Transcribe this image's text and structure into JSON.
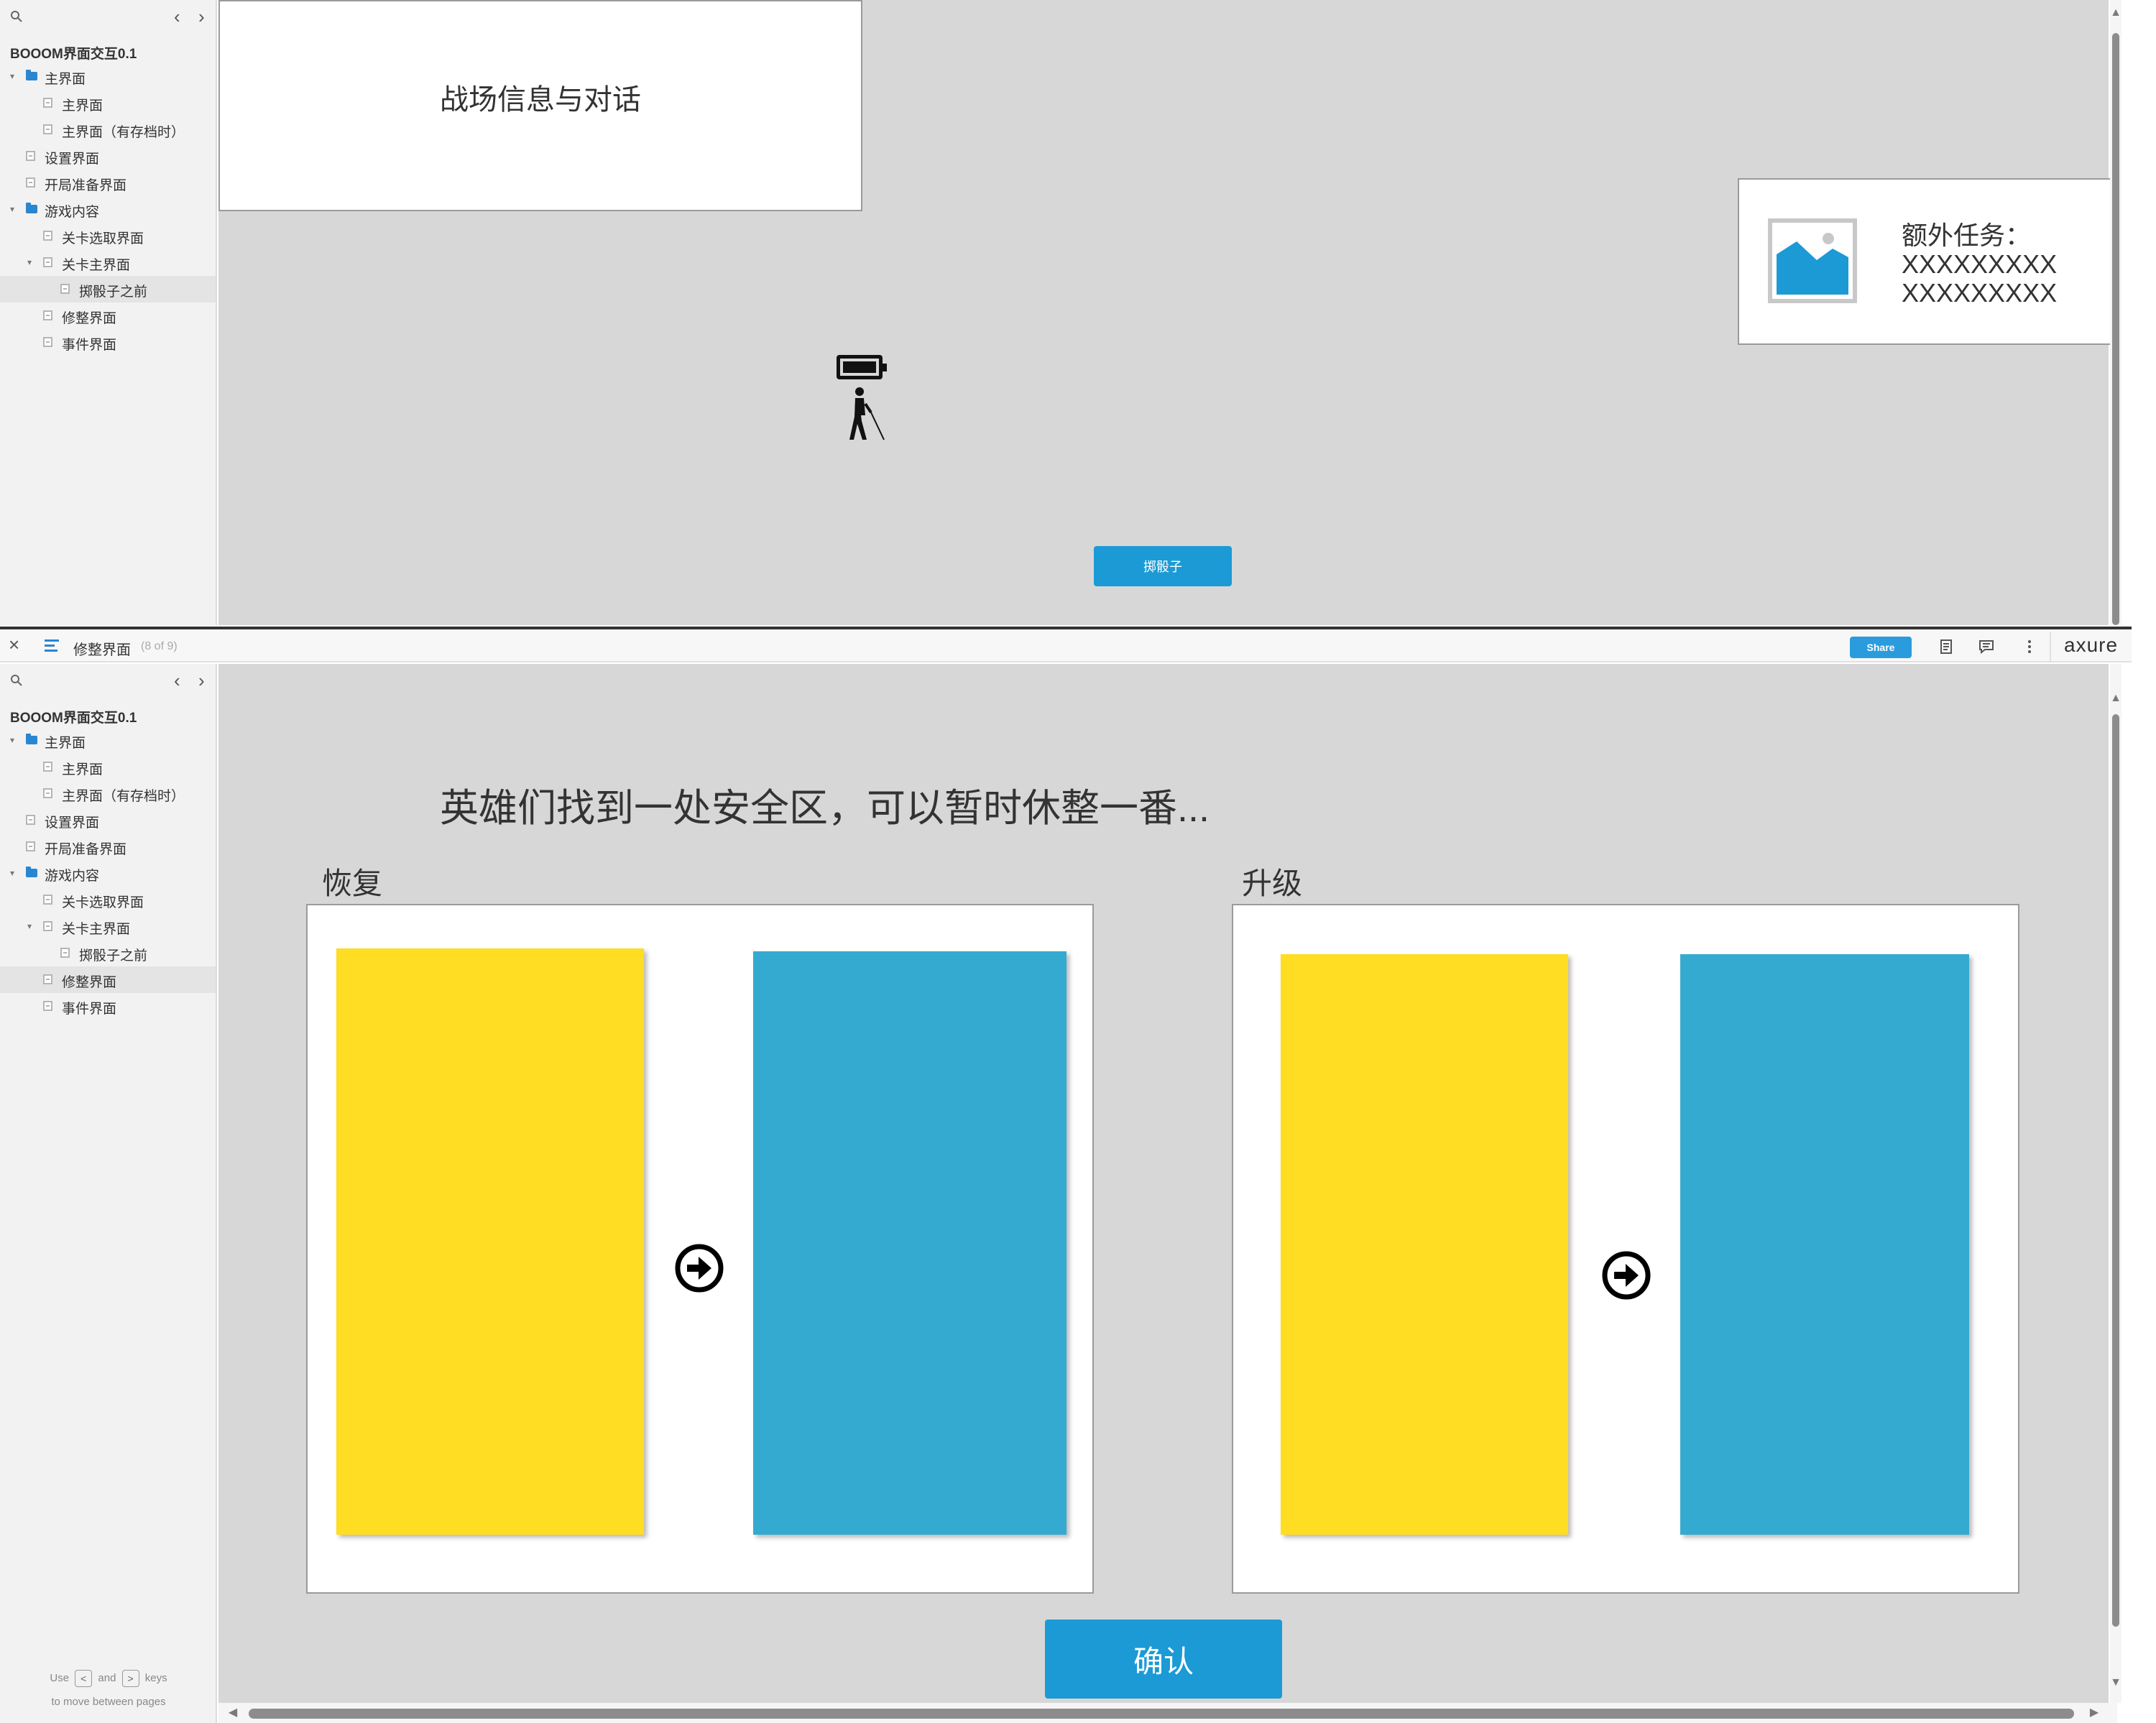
{
  "project_title": "BOOOM界面交互0.1",
  "sitemap": [
    {
      "label": "主界面",
      "type": "folder",
      "level": 0
    },
    {
      "label": "主界面",
      "type": "page",
      "level": 1
    },
    {
      "label": "主界面（有存档时）",
      "type": "page",
      "level": 1
    },
    {
      "label": "设置界面",
      "type": "page",
      "level": 0
    },
    {
      "label": "开局准备界面",
      "type": "page",
      "level": 0
    },
    {
      "label": "游戏内容",
      "type": "folder",
      "level": 0
    },
    {
      "label": "关卡选取界面",
      "type": "page",
      "level": 1
    },
    {
      "label": "关卡主界面",
      "type": "page",
      "level": 1
    },
    {
      "label": "掷骰子之前",
      "type": "page",
      "level": 2
    },
    {
      "label": "修整界面",
      "type": "page",
      "level": 1
    },
    {
      "label": "事件界面",
      "type": "page",
      "level": 1
    }
  ],
  "top_window": {
    "dialog_title": "战场信息与对话",
    "task_label": "额外任务：",
    "task_lines": [
      "XXXXXXXXX",
      "XXXXXXXXX"
    ],
    "dice_button": "掷骰子",
    "selected_page": "掷骰子之前"
  },
  "toolbar": {
    "close": "×",
    "page_name": "修整界面",
    "page_count": "(8 of 9)",
    "share_label": "Share",
    "brand": "axure"
  },
  "bottom_window": {
    "selected_page": "修整界面",
    "headline": "英雄们找到一处安全区，可以暂时休整一番...",
    "recover_label": "恢复",
    "upgrade_label": "升级",
    "confirm_button": "确认",
    "hint": {
      "use": "Use",
      "and": "and",
      "keys": "keys",
      "line2": "to move between pages",
      "prev_key": "<",
      "next_key": ">"
    }
  },
  "colors": {
    "canvas_bg": "#d7d7d7",
    "card_yellow": "#ffdd22",
    "card_blue": "#35aad0",
    "button_blue": "#1b9ad6",
    "folder_blue": "#2a86d1"
  }
}
